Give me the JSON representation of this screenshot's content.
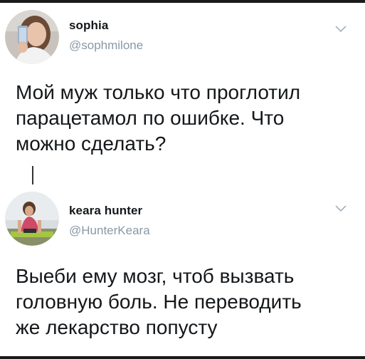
{
  "tweets": [
    {
      "name": "sophia",
      "handle": "@sophmilone",
      "text": "Мой муж только что проглотил\nпарацетамол по ошибке. Что\nможно сделать?",
      "avatar_icon": "avatar-sophia"
    },
    {
      "name": "keara hunter",
      "handle": "@HunterKeara",
      "text": "Выеби ему мозг, чтоб вызвать\nголовную боль. Не переводить\nже лекарство попусту",
      "avatar_icon": "avatar-keara"
    }
  ],
  "colors": {
    "text": "#14171a",
    "secondary": "#8899a6",
    "background": "#ffffff"
  }
}
